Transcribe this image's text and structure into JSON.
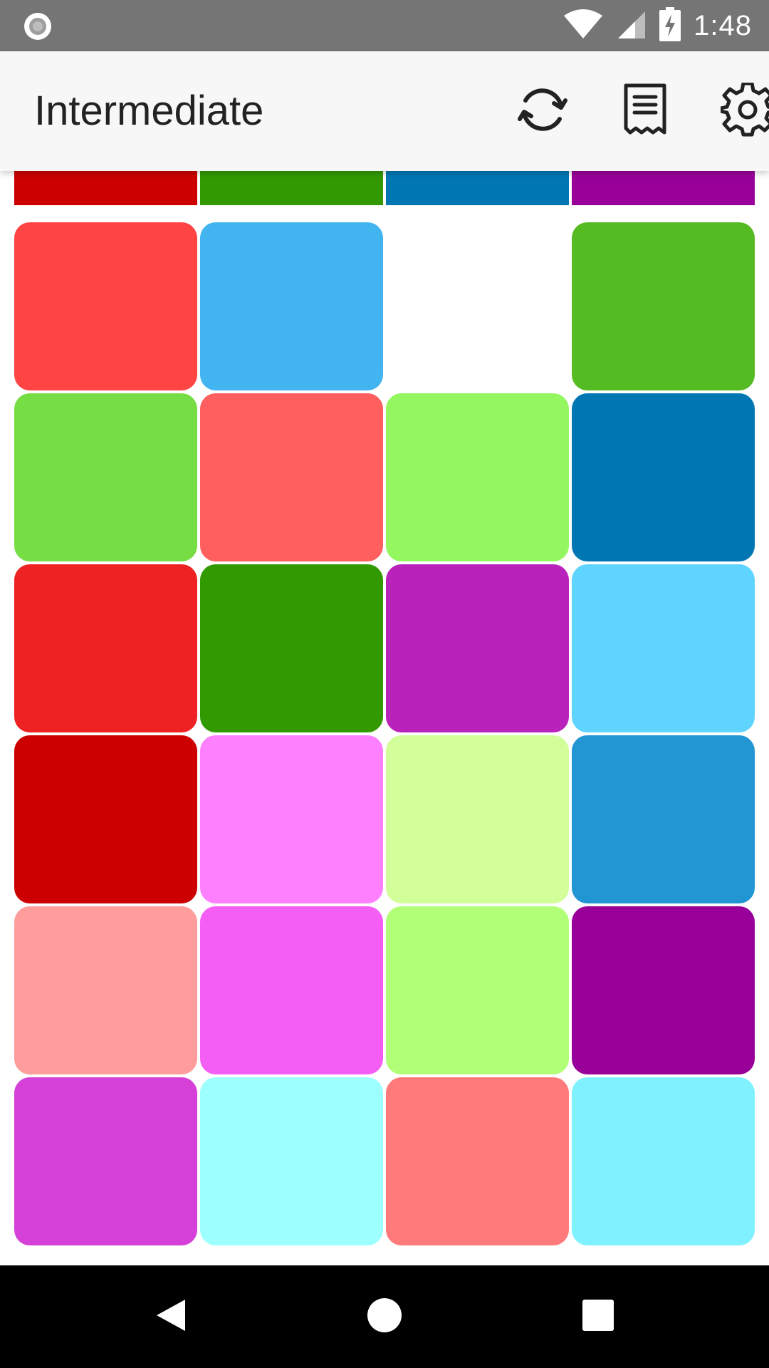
{
  "status_bar": {
    "time": "1:48",
    "icons": [
      "notification-icon",
      "wifi-icon",
      "cell-signal-icon",
      "battery-charging-icon"
    ]
  },
  "app_bar": {
    "title": "Intermediate",
    "actions": [
      {
        "name": "refresh-icon"
      },
      {
        "name": "receipt-icon"
      },
      {
        "name": "settings-icon"
      }
    ]
  },
  "target_colors": [
    "#cc0000",
    "#339900",
    "#0077b3",
    "#990099"
  ],
  "tiles": [
    "#ff4444",
    "#42b4f0",
    null,
    "#55bb22",
    "#77dd44",
    "#ff5f5f",
    "#94f760",
    "#0077b3",
    "#ee2222",
    "#339900",
    "#b922bb",
    "#5fd4ff",
    "#cc0000",
    "#ff80ff",
    "#d2ff99",
    "#2196d3",
    "#ff9d9d",
    "#f55ef5",
    "#b0ff77",
    "#990099",
    "#d440d8",
    "#9effff",
    "#ff7b7b",
    "#80f2ff"
  ],
  "nav_bar": {
    "buttons": [
      "back-icon",
      "home-icon",
      "recents-icon"
    ]
  }
}
